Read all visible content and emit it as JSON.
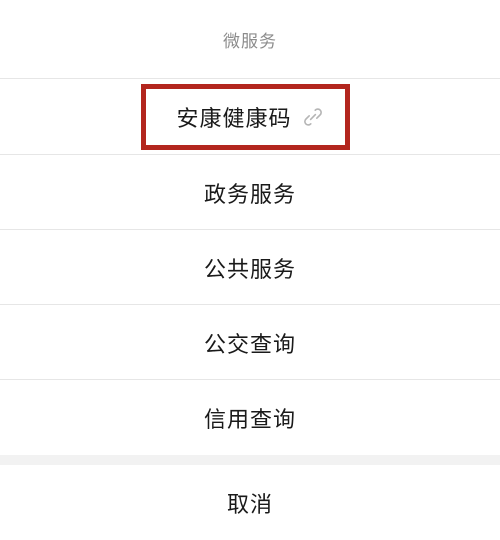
{
  "sheet": {
    "title": "微服务",
    "items": [
      {
        "label": "安康健康码",
        "icon": "mini-program-link-icon",
        "highlighted": true
      },
      {
        "label": "政务服务"
      },
      {
        "label": "公共服务"
      },
      {
        "label": "公交查询"
      },
      {
        "label": "信用查询"
      }
    ],
    "cancel_label": "取消"
  },
  "colors": {
    "highlight_border": "#b3261e",
    "title_text": "#8c8c8c",
    "item_text": "#1a1a1a",
    "divider": "#e6e6e6",
    "gap_band": "#f2f2f2"
  }
}
